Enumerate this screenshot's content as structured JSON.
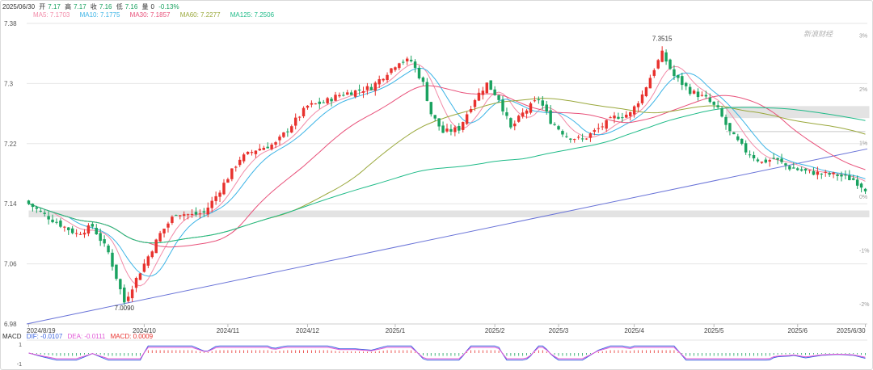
{
  "header": {
    "date": "2025/06/30",
    "open_label": "开",
    "open": "7.17",
    "high_label": "高",
    "high": "7.17",
    "close_label": "收",
    "close": "7.16",
    "low_label": "低",
    "low": "7.16",
    "vol_label": "量",
    "vol": "0",
    "change": "-0.13%"
  },
  "ma_legend": [
    {
      "label": "MA5: 7.1703",
      "color": "#f28ba8"
    },
    {
      "label": "MA10: 7.1775",
      "color": "#3cb4e6"
    },
    {
      "label": "MA30: 7.1857",
      "color": "#e8517a"
    },
    {
      "label": "MA60: 7.2277",
      "color": "#9aa83c"
    },
    {
      "label": "MA125: 7.2506",
      "color": "#1fbb88"
    }
  ],
  "macd_legend": {
    "title": "MACD",
    "dif": "DIF: -0.0107",
    "dea": "DEA: -0.0111",
    "macd": "MACD: 0.0009"
  },
  "watermark": "新浪财经",
  "colors": {
    "up": "#e8322e",
    "down": "#1aa260",
    "grid": "#e6e6e6",
    "trend": "#6a74d8",
    "band": "#e3e3e3"
  },
  "chart_data": {
    "type": "candlestick",
    "y_ticks": [
      "7.38",
      "7.3",
      "7.22",
      "7.14",
      "7.06",
      "6.98"
    ],
    "y_tick_values": [
      7.38,
      7.3,
      7.22,
      7.14,
      7.06,
      6.98
    ],
    "ylim": [
      6.98,
      7.38
    ],
    "pct_ticks": [
      "3%",
      "2%",
      "1%",
      "0%",
      "-1%",
      "-2%",
      "-3%"
    ],
    "pct_tick_values": [
      0.03,
      0.02,
      0.01,
      0,
      -0.01,
      -0.02,
      -0.03
    ],
    "pct_base": 7.15,
    "x_labels": [
      "2024/8/19",
      "2024/10",
      "2024/11",
      "2024/12",
      "2025/1",
      "2025/2",
      "2025/3",
      "2025/4",
      "2025/5",
      "2025/6",
      "2025/6/30"
    ],
    "x_label_bars": [
      0,
      29,
      50,
      70,
      92,
      117,
      133,
      152,
      172,
      193,
      210
    ],
    "annotations": [
      {
        "text": "7.3515",
        "bar": 159,
        "value": 7.3515,
        "pos": "above"
      },
      {
        "text": "7.0090",
        "bar": 24,
        "value": 7.009,
        "pos": "below"
      }
    ],
    "trendline": {
      "from_bar": 0,
      "from_value": 6.98,
      "to_bar": 210,
      "to_value": 7.213
    },
    "bands": [
      {
        "y_top": 7.27,
        "y_bottom": 7.254,
        "from_bar": 175,
        "to_bar": 210
      },
      {
        "y_top": 7.131,
        "y_bottom": 7.122,
        "from_bar": 0,
        "to_bar": 210
      }
    ],
    "dashed_lines": [
      {
        "value": 7.236,
        "from_bar": 175,
        "to_bar": 210
      }
    ],
    "anchors": [
      [
        0,
        7.14
      ],
      [
        4,
        7.125
      ],
      [
        8,
        7.112
      ],
      [
        12,
        7.1
      ],
      [
        16,
        7.11
      ],
      [
        20,
        7.075
      ],
      [
        24,
        7.009
      ],
      [
        27,
        7.04
      ],
      [
        30,
        7.07
      ],
      [
        33,
        7.1
      ],
      [
        37,
        7.128
      ],
      [
        41,
        7.125
      ],
      [
        44,
        7.128
      ],
      [
        47,
        7.15
      ],
      [
        50,
        7.175
      ],
      [
        53,
        7.2
      ],
      [
        57,
        7.212
      ],
      [
        62,
        7.22
      ],
      [
        66,
        7.245
      ],
      [
        70,
        7.27
      ],
      [
        74,
        7.275
      ],
      [
        78,
        7.285
      ],
      [
        82,
        7.29
      ],
      [
        86,
        7.295
      ],
      [
        89,
        7.31
      ],
      [
        93,
        7.33
      ],
      [
        96,
        7.33
      ],
      [
        99,
        7.3
      ],
      [
        101,
        7.26
      ],
      [
        104,
        7.235
      ],
      [
        108,
        7.24
      ],
      [
        112,
        7.28
      ],
      [
        115,
        7.3
      ],
      [
        118,
        7.28
      ],
      [
        121,
        7.24
      ],
      [
        124,
        7.26
      ],
      [
        128,
        7.28
      ],
      [
        131,
        7.25
      ],
      [
        135,
        7.23
      ],
      [
        139,
        7.225
      ],
      [
        143,
        7.24
      ],
      [
        147,
        7.255
      ],
      [
        151,
        7.26
      ],
      [
        154,
        7.285
      ],
      [
        157,
        7.32
      ],
      [
        159,
        7.34
      ],
      [
        162,
        7.31
      ],
      [
        166,
        7.29
      ],
      [
        170,
        7.28
      ],
      [
        173,
        7.265
      ],
      [
        176,
        7.235
      ],
      [
        180,
        7.21
      ],
      [
        184,
        7.195
      ],
      [
        187,
        7.2
      ],
      [
        191,
        7.188
      ],
      [
        195,
        7.183
      ],
      [
        199,
        7.18
      ],
      [
        203,
        7.178
      ],
      [
        207,
        7.172
      ],
      [
        210,
        7.16
      ]
    ],
    "series": [
      {
        "name": "MA5",
        "color": "#f28ba8",
        "lag": 3
      },
      {
        "name": "MA10",
        "color": "#3cb4e6",
        "lag": 5
      },
      {
        "name": "MA30",
        "color": "#e8517a",
        "lag": 15
      },
      {
        "name": "MA60",
        "color": "#9aa83c",
        "lag": 30
      },
      {
        "name": "MA125",
        "color": "#1fbb88",
        "lag": 62
      }
    ],
    "macd": {
      "ylim": [
        -1,
        1
      ],
      "ticks": [
        "1",
        "-1"
      ],
      "dif_color": "#3b63e0",
      "dea_color": "#e056d6"
    },
    "grid": true
  }
}
